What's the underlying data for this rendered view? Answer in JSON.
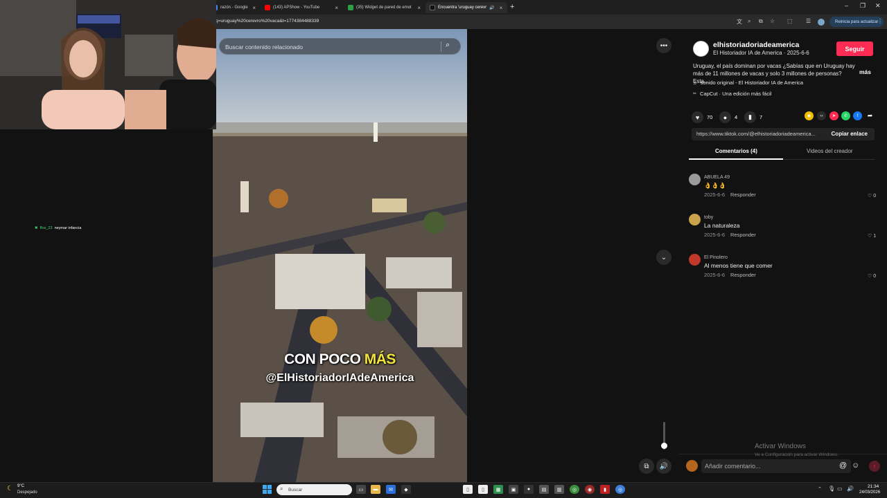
{
  "browser": {
    "tabs": [
      {
        "label": "razón - Google",
        "favicon_color": "#4285f4"
      },
      {
        "label": "(143) APShow - YouTube",
        "favicon_color": "#ff0000"
      },
      {
        "label": "(35) Widget de pared de emot",
        "favicon_color": "#2ea043"
      },
      {
        "label": "Encuentra 'uruguay cerevr",
        "favicon_color": "#111111"
      }
    ],
    "url": "q=uruguay%20cerevro%20vaca&t=1774384488339",
    "update_button": "Reinicia para actualizar"
  },
  "stream_chat": {
    "user": "ffox_23",
    "message": "neymar infancia"
  },
  "search": {
    "placeholder": "Buscar contenido relacionado"
  },
  "video": {
    "caption_line1": "CON POCO",
    "caption_highlight": "MÁS",
    "caption_line2": "@ElHistoriadorIAdeAmerica",
    "volume_fraction": 0.15
  },
  "author": {
    "username": "elhistoriadoriadeamerica",
    "display_name": "El Historiador IA de America",
    "date": "2025-6-6",
    "follow_label": "Seguir",
    "description": "Uruguay, el país dominan por vacas ¿Sabías que en Uruguay hay más de 11 millones de vacas y solo 3 millones de personas? Esta...",
    "more_label": "más",
    "sound": "sonido original - El Historiador IA de America",
    "capcut": "CapCut · Una edición más fácil"
  },
  "stats": {
    "likes": "70",
    "comments": "4",
    "saves": "7"
  },
  "share": {
    "link": "https://www.tiktok.com/@elhistoriadoriadeamerica...",
    "copy_label": "Copiar enlace"
  },
  "panel_tabs": {
    "comments": "Comentarios (4)",
    "creator": "Videos del creador"
  },
  "comments": [
    {
      "name": "ABUELA 49",
      "text": "👌👌👌",
      "date": "2025-6-6",
      "reply": "Responder",
      "likes": "0",
      "avatar_color": "#9a9a9a"
    },
    {
      "name": "toby",
      "text": "La naturaleza",
      "date": "2025-6-6",
      "reply": "Responder",
      "likes": "1",
      "avatar_color": "#c9a24a"
    },
    {
      "name": "El Pinolero",
      "text": "Al menos tiene que comer",
      "date": "2025-6-6",
      "reply": "Responder",
      "likes": "0",
      "avatar_color": "#c0392b"
    }
  ],
  "comment_box": {
    "placeholder": "Añadir comentario..."
  },
  "windows_notice": {
    "line1": "Activar Windows",
    "line2": "Ve a Configuración para activar Windows."
  },
  "taskbar": {
    "weather_temp": "9°C",
    "weather_desc": "Despejado",
    "search_placeholder": "Buscar",
    "time": "21:34",
    "date": "24/03/2026"
  },
  "colors": {
    "accent": "#fe2c55",
    "highlight": "#f2e43a"
  }
}
